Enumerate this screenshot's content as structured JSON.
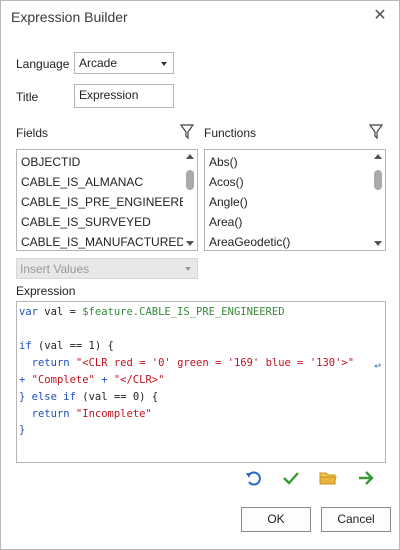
{
  "dialog": {
    "title": "Expression Builder"
  },
  "language": {
    "label": "Language",
    "value": "Arcade"
  },
  "title_field": {
    "label": "Title",
    "value": "Expression"
  },
  "fields": {
    "label": "Fields",
    "items": [
      "OBJECTID",
      "CABLE_IS_ALMANAC",
      "CABLE_IS_PRE_ENGINEERED",
      "CABLE_IS_SURVEYED",
      "CABLE_IS_MANUFACTURED"
    ]
  },
  "functions": {
    "label": "Functions",
    "items": [
      "Abs()",
      "Acos()",
      "Angle()",
      "Area()",
      "AreaGeodetic()"
    ]
  },
  "insert_values": {
    "placeholder": "Insert Values"
  },
  "expression": {
    "label": "Expression",
    "code": {
      "l1_kw": "var",
      "l1_mid": " val = ",
      "l1_fld": "$feature.CABLE_IS_PRE_ENGINEERED",
      "l3_kw": "if",
      "l3_rest": " (val == 1) {",
      "l4_kw": "return",
      "l4_str": "\"<CLR red = '0' green = '169' blue = '130'>\"",
      "l5_plus1": "+ ",
      "l5_str1": "\"Complete\"",
      "l5_plus2": " + ",
      "l5_str2": "\"</CLR>\"",
      "l6_brace": "} ",
      "l6_kw1": "else",
      "l6_sp": " ",
      "l6_kw2": "if",
      "l6_rest": " (val == 0) {",
      "l7_kw": "return",
      "l7_str": "\"Incomplete\"",
      "l8": "}"
    }
  },
  "toolbar": {
    "undo_icon": "undo-icon",
    "verify_icon": "checkmark-icon",
    "open_icon": "folder-icon",
    "run_icon": "arrow-right-icon"
  },
  "buttons": {
    "ok": "OK",
    "cancel": "Cancel"
  },
  "colors": {
    "accent_blue": "#2b67c9",
    "green": "#3a9a3a",
    "folder": "#e8b43a",
    "keyword": "#1f4fbf",
    "string": "#c2121f"
  }
}
